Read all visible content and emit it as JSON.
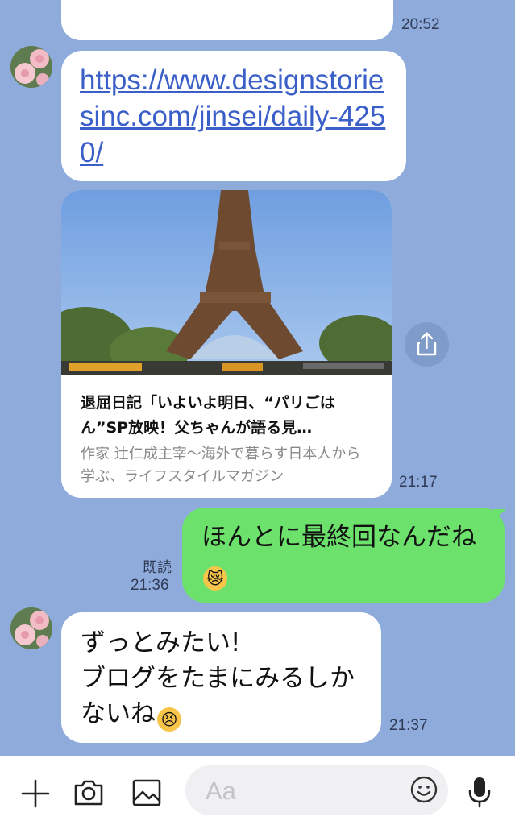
{
  "messages": {
    "top_time": "20:52",
    "link": {
      "text": "https://www.designstoriesinc.com/jinsei/daily-4250/"
    },
    "preview": {
      "title": "退屈日記「いよいよ明日、“パリごはん”SP放映！父ちゃんが語る見…",
      "description": "作家 辻仁成主宰〜海外で暮らす日本人から学ぶ、ライフスタイルマガジン",
      "time": "21:17"
    },
    "sent": {
      "text": "ほんとに最終回なんだね",
      "read_label": "既読",
      "time": "21:36"
    },
    "received": {
      "text": "ずっとみたい!\nブログをたまにみるしかないね",
      "time": "21:37"
    }
  },
  "input_bar": {
    "placeholder": "Aa",
    "icons": [
      "plus-icon",
      "camera-icon",
      "image-icon",
      "emoji-icon",
      "microphone-icon"
    ]
  },
  "colors": {
    "background": "#8fabdb",
    "sent_bubble": "#6ce26c",
    "received_bubble": "#ffffff",
    "link": "#3b5fc8"
  }
}
